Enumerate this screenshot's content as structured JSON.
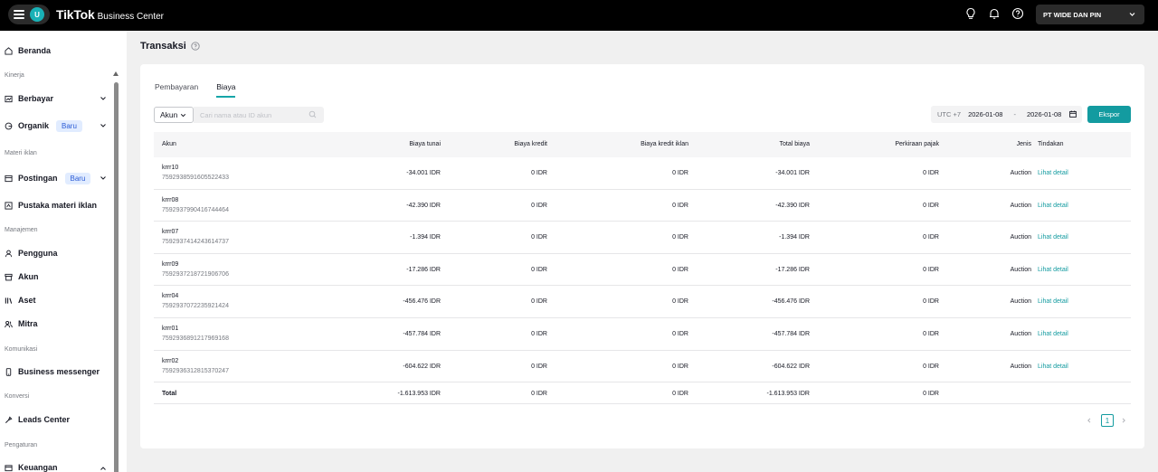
{
  "topbar": {
    "avatar_letter": "U",
    "brand_main": "TikTok",
    "brand_sub": "Business Center",
    "company": "PT WIDE DAN PIN"
  },
  "sidebar": {
    "home": "Beranda",
    "section_kinerja": "Kinerja",
    "berbayar": "Berbayar",
    "organik": "Organik",
    "badge_baru": "Baru",
    "section_materi": "Materi iklan",
    "postingan": "Postingan",
    "pustaka": "Pustaka materi iklan",
    "section_manajemen": "Manajemen",
    "pengguna": "Pengguna",
    "akun": "Akun",
    "aset": "Aset",
    "mitra": "Mitra",
    "section_komunikasi": "Komunikasi",
    "messenger": "Business messenger",
    "section_konversi": "Konversi",
    "leads": "Leads Center",
    "section_pengaturan": "Pengaturan",
    "keuangan": "Keuangan"
  },
  "main": {
    "title": "Transaksi",
    "tabs": [
      "Pembayaran",
      "Biaya"
    ],
    "account_select": "Akun",
    "search_placeholder": "Cari nama atau ID akun",
    "timezone": "UTC +7",
    "date_start": "2026-01-08",
    "date_sep": "-",
    "date_end": "2026-01-08",
    "export_label": "Ekspor"
  },
  "table": {
    "headers": [
      "Akun",
      "Biaya tunai",
      "Biaya kredit",
      "Biaya kredit iklan",
      "Total biaya",
      "Perkiraan pajak",
      "Jenis",
      "Tindakan"
    ],
    "rows": [
      {
        "name": "krrr10",
        "id": "7592938591605522433",
        "cash": "-34.001 IDR",
        "credit": "0 IDR",
        "ad_credit": "0 IDR",
        "total": "-34.001 IDR",
        "tax": "0 IDR",
        "type": "Auction",
        "action": "Lihat detail"
      },
      {
        "name": "krrr08",
        "id": "7592937990416744464",
        "cash": "-42.390 IDR",
        "credit": "0 IDR",
        "ad_credit": "0 IDR",
        "total": "-42.390 IDR",
        "tax": "0 IDR",
        "type": "Auction",
        "action": "Lihat detail"
      },
      {
        "name": "krrr07",
        "id": "7592937414243614737",
        "cash": "-1.394 IDR",
        "credit": "0 IDR",
        "ad_credit": "0 IDR",
        "total": "-1.394 IDR",
        "tax": "0 IDR",
        "type": "Auction",
        "action": "Lihat detail"
      },
      {
        "name": "krrr09",
        "id": "7592937218721906706",
        "cash": "-17.286 IDR",
        "credit": "0 IDR",
        "ad_credit": "0 IDR",
        "total": "-17.286 IDR",
        "tax": "0 IDR",
        "type": "Auction",
        "action": "Lihat detail"
      },
      {
        "name": "krrr04",
        "id": "7592937072235921424",
        "cash": "-456.476 IDR",
        "credit": "0 IDR",
        "ad_credit": "0 IDR",
        "total": "-456.476 IDR",
        "tax": "0 IDR",
        "type": "Auction",
        "action": "Lihat detail"
      },
      {
        "name": "krrr01",
        "id": "7592936891217969168",
        "cash": "-457.784 IDR",
        "credit": "0 IDR",
        "ad_credit": "0 IDR",
        "total": "-457.784 IDR",
        "tax": "0 IDR",
        "type": "Auction",
        "action": "Lihat detail"
      },
      {
        "name": "krrr02",
        "id": "7592936312815370247",
        "cash": "-604.622 IDR",
        "credit": "0 IDR",
        "ad_credit": "0 IDR",
        "total": "-604.622 IDR",
        "tax": "0 IDR",
        "type": "Auction",
        "action": "Lihat detail"
      }
    ],
    "total": {
      "label": "Total",
      "cash": "-1.613.953 IDR",
      "credit": "0 IDR",
      "ad_credit": "0 IDR",
      "total": "-1.613.953 IDR",
      "tax": "0 IDR"
    }
  },
  "pagination": {
    "current": "1"
  },
  "colors": {
    "accent": "#139ba0",
    "topbar": "#000000"
  }
}
